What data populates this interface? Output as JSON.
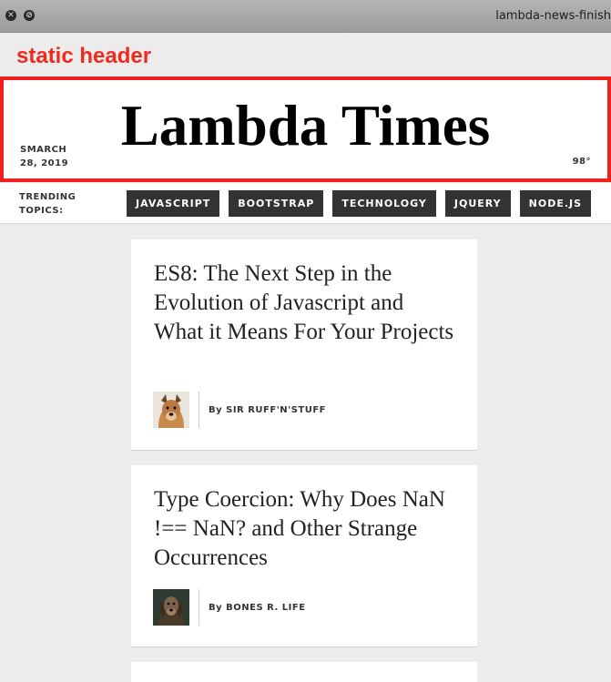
{
  "window": {
    "title": "lambda-news-finish",
    "close_glyph": "✕",
    "min_glyph": "⊘"
  },
  "annotation": {
    "label": "static header",
    "color": "#f21f1f"
  },
  "header": {
    "brand": "Lambda Times",
    "date_line1": "SMARCH",
    "date_line2": "28, 2019",
    "temperature": "98°"
  },
  "topics": {
    "title_line1": "TRENDING",
    "title_line2": "TOPICS:",
    "tabs": [
      {
        "label": "JAVASCRIPT"
      },
      {
        "label": "BOOTSTRAP"
      },
      {
        "label": "TECHNOLOGY"
      },
      {
        "label": "JQUERY"
      },
      {
        "label": "NODE.JS"
      }
    ]
  },
  "articles": [
    {
      "headline": "ES8: The Next Step in the Evolution of Javascript and What it Means For Your Projects",
      "byline": "By SIR RUFF'N'STUFF",
      "avatar_icon": "dog-avatar-icon"
    },
    {
      "headline": "Type Coercion: Why Does NaN !== NaN? and Other Strange Occurrences",
      "byline": "By BONES R. LIFE",
      "avatar_icon": "dog-avatar-icon"
    }
  ]
}
